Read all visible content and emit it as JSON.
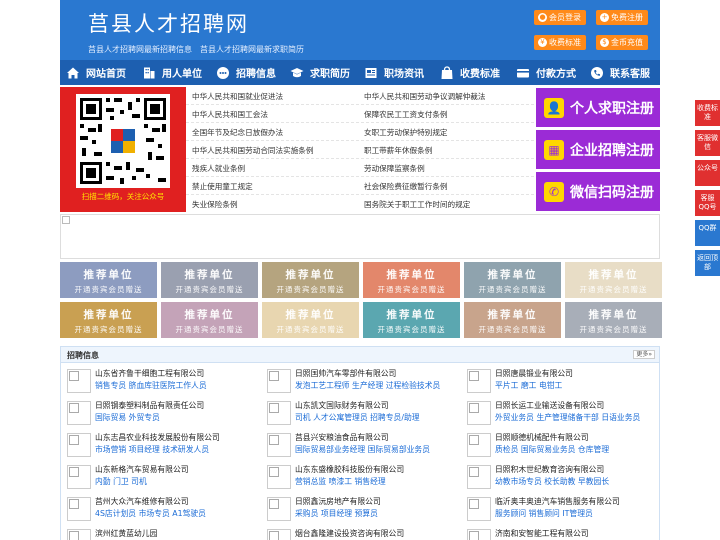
{
  "header": {
    "title": "莒县人才招聘网",
    "subtitle": "莒县人才招聘网最新招聘信息　莒县人才招聘网最新求职简历",
    "buttons": [
      {
        "label": "会员登录",
        "icon": "user-icon"
      },
      {
        "label": "免费注册",
        "icon": "user-plus-icon"
      },
      {
        "label": "收费标准",
        "icon": "yen-icon"
      },
      {
        "label": "金币充值",
        "icon": "coin-icon"
      }
    ]
  },
  "nav": [
    {
      "label": "网站首页",
      "icon": "home-icon"
    },
    {
      "label": "用人单位",
      "icon": "building-icon"
    },
    {
      "label": "招聘信息",
      "icon": "chat-icon"
    },
    {
      "label": "求职简历",
      "icon": "cap-icon"
    },
    {
      "label": "职场资讯",
      "icon": "news-icon"
    },
    {
      "label": "收费标准",
      "icon": "bag-icon"
    },
    {
      "label": "付款方式",
      "icon": "card-icon"
    },
    {
      "label": "联系客服",
      "icon": "phone-icon"
    }
  ],
  "qr": {
    "caption": "扫描二维码，关注公众号"
  },
  "laws": {
    "left": [
      "中华人民共和国就业促进法",
      "中华人民共和国工会法",
      "全国年节及纪念日放假办法",
      "中华人民共和国劳动合同法实施条例",
      "残疾人就业条例",
      "禁止使用童工规定",
      "失业保险条例"
    ],
    "right": [
      "中华人民共和国劳动争议调解仲裁法",
      "保障农民工工资支付条例",
      "女职工劳动保护特别规定",
      "职工带薪年休假条例",
      "劳动保障监察条例",
      "社会保险费征缴暂行条例",
      "国务院关于职工工作时间的规定"
    ]
  },
  "register": [
    {
      "label": "个人求职注册",
      "icon": "person-icon"
    },
    {
      "label": "企业招聘注册",
      "icon": "company-icon"
    },
    {
      "label": "微信扫码注册",
      "icon": "wechat-icon"
    }
  ],
  "side": [
    "收费标准",
    "客服微信",
    "公众号",
    "客服QQ号",
    "QQ群",
    "返回顶部"
  ],
  "recommend": {
    "title": "推荐单位",
    "sub": "开通贵宾会员赠送",
    "colors": [
      "#8d9cc0",
      "#9aa0b0",
      "#b5a47f",
      "#e3876b",
      "#8fa3ae",
      "#e8ddc6",
      "#c9a052",
      "#c4a3b8",
      "#e8d6b0",
      "#5ba7b0",
      "#c8a48c",
      "#a8aeb8"
    ]
  },
  "jobs": {
    "title": "招聘信息",
    "more": "更多»",
    "items": [
      {
        "company": "山东省齐鲁干细胞工程有限公司",
        "positions": "销售专员 脐血库驻医院工作人员"
      },
      {
        "company": "日照国帅汽车零部件有限公司",
        "positions": "发泡工艺工程师 生产经理 过程检验技术员"
      },
      {
        "company": "日照唐晨锻业有限公司",
        "positions": "平片工 磨工 电钳工"
      },
      {
        "company": "日照钢泰塑料制品有限责任公司",
        "positions": "国际贸易 外贸专员"
      },
      {
        "company": "山东凯文国际财务有限公司",
        "positions": "司机 人才公寓管理员 招聘专员/助理"
      },
      {
        "company": "日照长运工业输送设备有限公司",
        "positions": "外贸业务员 生产管理储备干部 日语业务员"
      },
      {
        "company": "山东志昌农业科技发展股份有限公司",
        "positions": "市场营销 项目经理 技术研发人员"
      },
      {
        "company": "莒县兴安粮油食品有限公司",
        "positions": "国际贸易部业务经理 国际贸易部业务员"
      },
      {
        "company": "日照顺德机械配件有限公司",
        "positions": "质检员 国际贸易业务员 仓库管理"
      },
      {
        "company": "山东新格汽车贸易有限公司",
        "positions": "内勤 门卫 司机"
      },
      {
        "company": "山东东盛橡胶科技股份有限公司",
        "positions": "营销总监 喷漆工 销售经理"
      },
      {
        "company": "日照积木世纪教育咨询有限公司",
        "positions": "幼教市场专员 校长助教 早教园长"
      },
      {
        "company": "莒州大众汽车维修有限公司",
        "positions": "4S店计划员 市场专员 A1驾驶员"
      },
      {
        "company": "日照鑫沅房地产有限公司",
        "positions": "采购员 项目经理 预算员"
      },
      {
        "company": "临沂奥丰奥迪汽车销售服务有限公司",
        "positions": "服务顾问 销售顾问 IT管理员"
      },
      {
        "company": "滨州红黄蓝幼儿园",
        "positions": "幼儿教师"
      },
      {
        "company": "烟台鑫隆建设投资咨询有限公司",
        "positions": "销售经理 办公文员"
      },
      {
        "company": "济南和安智能工程有限公司",
        "positions": "预算员"
      }
    ]
  }
}
